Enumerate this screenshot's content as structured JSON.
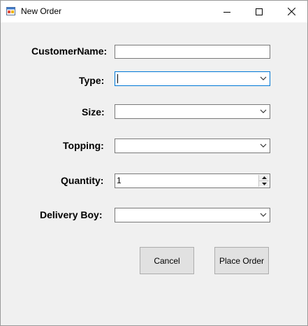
{
  "window": {
    "title": "New Order"
  },
  "form": {
    "customer_name": {
      "label": "CustomerName:",
      "value": ""
    },
    "type": {
      "label": "Type:",
      "value": ""
    },
    "size": {
      "label": "Size:",
      "value": ""
    },
    "topping": {
      "label": "Topping:",
      "value": ""
    },
    "quantity": {
      "label": "Quantity:",
      "value": "1"
    },
    "delivery_boy": {
      "label": "Delivery Boy:",
      "value": ""
    }
  },
  "buttons": {
    "cancel": "Cancel",
    "place_order": "Place Order"
  }
}
